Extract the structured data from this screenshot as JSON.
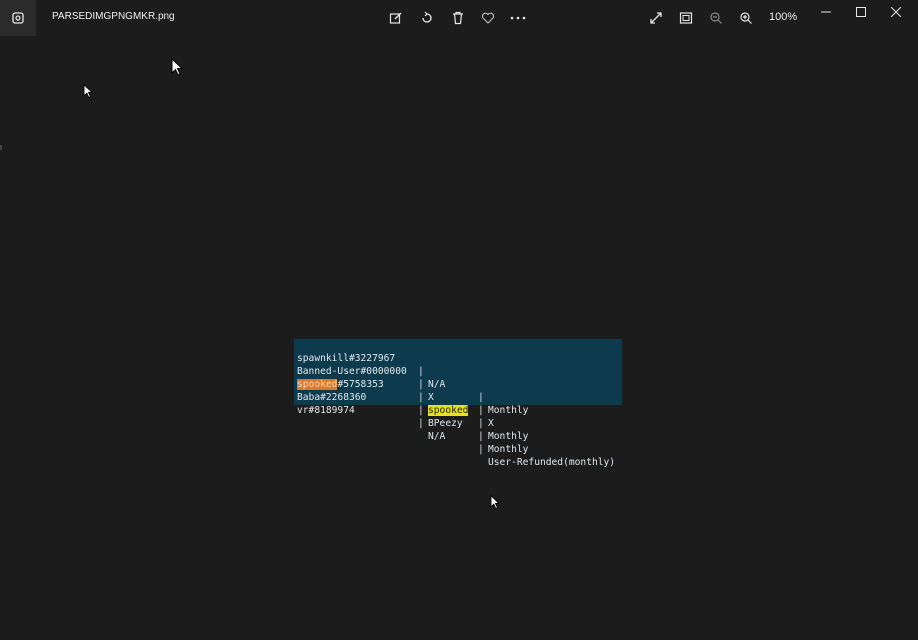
{
  "titlebar": {
    "filename": "PARSEDIMGPNGMKR.png",
    "zoom_level": "100%"
  },
  "icons": {
    "app": "photos-app-icon",
    "edit": "edit-image-icon",
    "rotate": "rotate-icon",
    "delete": "trash-icon",
    "favorite": "heart-icon",
    "more": "more-options-icon",
    "fullscreen": "fullscreen-icon",
    "fit": "fit-to-window-icon",
    "zoom_out": "zoom-out-icon",
    "zoom_in": "zoom-in-icon",
    "minimize": "minimize-icon",
    "maximize": "maximize-icon",
    "close": "close-icon"
  },
  "colors": {
    "background": "#1c1c1c",
    "image_background": "#0e3a4d",
    "highlight_orange": "#e07826",
    "highlight_yellow": "#e8e21c"
  },
  "image_rows": [
    {
      "user_prefix": "",
      "user_highlight": "",
      "user_rest": "spawnkill#3227967",
      "sep1": "|",
      "col2_highlight": "",
      "col2": "N/A",
      "sep2": "|",
      "col3": "Monthly"
    },
    {
      "user_prefix": "",
      "user_highlight": "",
      "user_rest": "Banned-User#0000000",
      "sep1": "|",
      "col2_highlight": "",
      "col2": "X",
      "sep2": "|",
      "col3": "X"
    },
    {
      "user_prefix": "",
      "user_highlight": "spooked",
      "user_rest": "#5758353",
      "sep1": "|",
      "col2_highlight": "spooked",
      "col2": "",
      "sep2": "|",
      "col3": "Monthly"
    },
    {
      "user_prefix": "",
      "user_highlight": "",
      "user_rest": "Baba#2268360",
      "sep1": "|",
      "col2_highlight": "",
      "col2": "BPeezy",
      "sep2": "|",
      "col3": "Monthly"
    },
    {
      "user_prefix": "",
      "user_highlight": "",
      "user_rest": "vr#8189974",
      "sep1": "|",
      "col2_highlight": "",
      "col2": "N/A",
      "sep2": "|",
      "col3": "User-Refunded(monthly)"
    }
  ]
}
